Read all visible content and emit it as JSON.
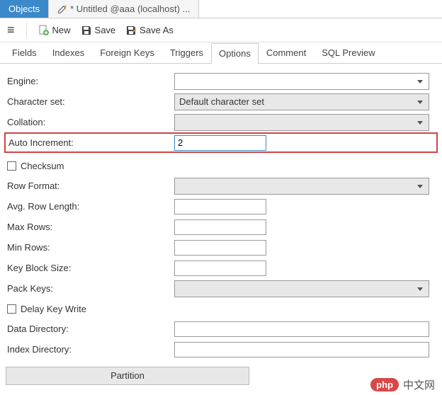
{
  "window_tabs": {
    "objects": "Objects",
    "untitled": "* Untitled @aaa (localhost) ..."
  },
  "toolbar": {
    "new_label": "New",
    "save_label": "Save",
    "save_as_label": "Save As"
  },
  "inner_tabs": [
    "Fields",
    "Indexes",
    "Foreign Keys",
    "Triggers",
    "Options",
    "Comment",
    "SQL Preview"
  ],
  "active_inner_tab": "Options",
  "options": {
    "engine_label": "Engine:",
    "engine_value": "",
    "charset_label": "Character set:",
    "charset_value": "Default character set",
    "collation_label": "Collation:",
    "collation_value": "",
    "auto_increment_label": "Auto Increment:",
    "auto_increment_value": "2",
    "checksum_label": "Checksum",
    "row_format_label": "Row Format:",
    "row_format_value": "",
    "avg_row_length_label": "Avg. Row Length:",
    "avg_row_length_value": "",
    "max_rows_label": "Max Rows:",
    "max_rows_value": "",
    "min_rows_label": "Min Rows:",
    "min_rows_value": "",
    "key_block_size_label": "Key Block Size:",
    "key_block_size_value": "",
    "pack_keys_label": "Pack Keys:",
    "pack_keys_value": "",
    "delay_key_write_label": "Delay Key Write",
    "data_directory_label": "Data Directory:",
    "data_directory_value": "",
    "index_directory_label": "Index Directory:",
    "index_directory_value": "",
    "partition_label": "Partition"
  },
  "watermark": {
    "badge": "php",
    "text": "中文网"
  }
}
